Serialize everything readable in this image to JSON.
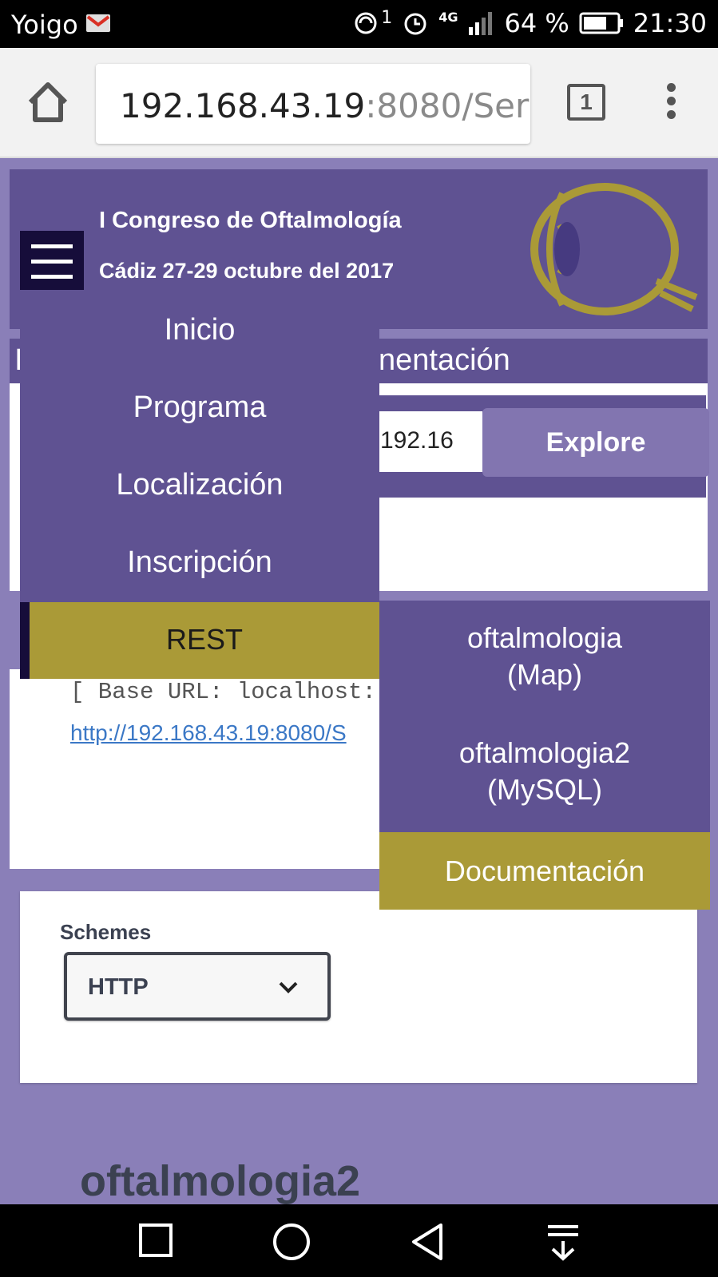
{
  "status_bar": {
    "carrier": "Yoigo",
    "sim_badge": "1",
    "network": "4G",
    "battery": "64 %",
    "time": "21:30"
  },
  "browser": {
    "url_host": "192.168.43.19",
    "url_rest": ":8080/Ser",
    "tab_count": "1"
  },
  "header": {
    "title": "I Congreso de Oftalmología",
    "subtitle": "Cádiz 27-29 octubre del 2017"
  },
  "nav_strip": {
    "left_peek": "I",
    "right_peek": "nentación"
  },
  "explore": {
    "input_value": "192.16",
    "button": "Explore"
  },
  "drawer": {
    "items": [
      "Inicio",
      "Programa",
      "Localización",
      "Inscripción"
    ],
    "active": "REST"
  },
  "submenu": {
    "items": [
      {
        "line1": "oftalmologia",
        "line2": "(Map)"
      },
      {
        "line1": "oftalmologia2",
        "line2": "(MySQL)"
      }
    ],
    "active": "Documentación"
  },
  "info": {
    "base_url": "[ Base URL: localhost:",
    "link": "http://192.168.43.19:8080/S"
  },
  "schemes": {
    "label": "Schemes",
    "selected": "HTTP"
  },
  "section": {
    "title": "oftalmologia2"
  },
  "colors": {
    "primary": "#5f5292",
    "accent": "#aa9a37",
    "dark": "#160d3a",
    "page_bg": "#8a7fb8"
  }
}
